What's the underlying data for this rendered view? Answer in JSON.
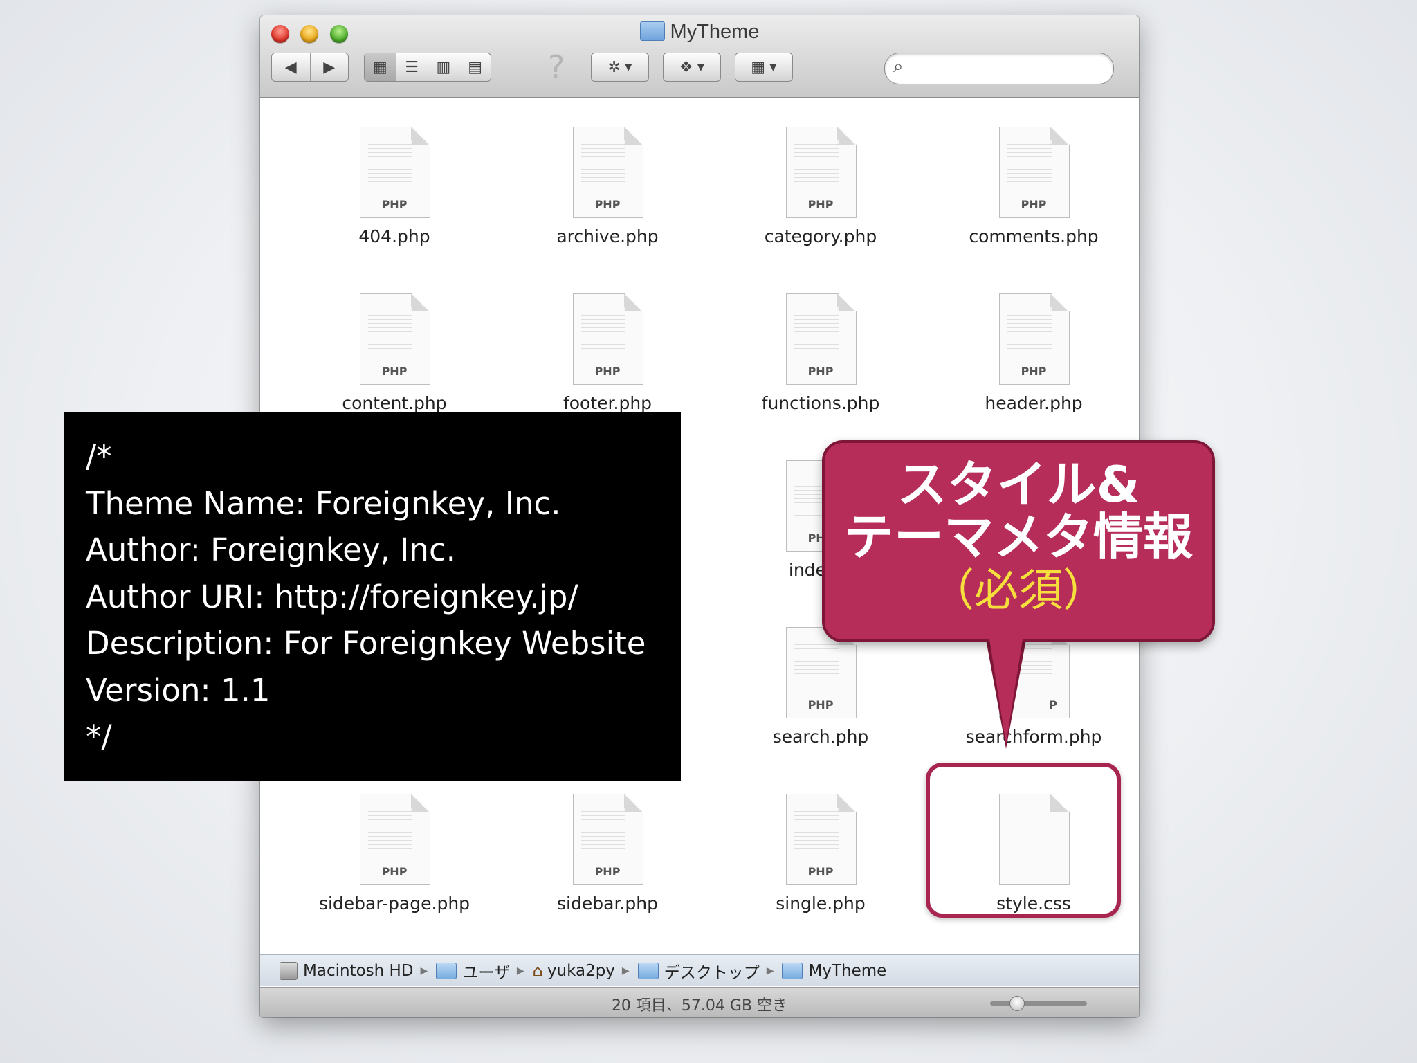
{
  "window": {
    "title": "MyTheme",
    "toolbar": {
      "back_icon": "back-arrow-icon",
      "forward_icon": "forward-arrow-icon",
      "view_modes": [
        "icon-view-icon",
        "list-view-icon",
        "column-view-icon",
        "coverflow-view-icon"
      ],
      "help_glyph": "?",
      "action_icon": "gear-icon",
      "dropbox_icon": "dropbox-icon",
      "arrange_icon": "arrange-icon",
      "search_placeholder": ""
    },
    "files": [
      {
        "name": "404.php",
        "type": "PHP"
      },
      {
        "name": "archive.php",
        "type": "PHP"
      },
      {
        "name": "category.php",
        "type": "PHP"
      },
      {
        "name": "comments.php",
        "type": "PHP"
      },
      {
        "name": "content.php",
        "type": "PHP"
      },
      {
        "name": "footer.php",
        "type": "PHP"
      },
      {
        "name": "functions.php",
        "type": "PHP"
      },
      {
        "name": "header.php",
        "type": "PHP"
      },
      {
        "name": "index.p",
        "type": "PHP"
      },
      {
        "name": "search.php",
        "type": "PHP"
      },
      {
        "name": "searchform.php",
        "type": "P"
      },
      {
        "name": "sidebar-page.php",
        "type": "PHP"
      },
      {
        "name": "sidebar.php",
        "type": "PHP"
      },
      {
        "name": "single.php",
        "type": "PHP"
      },
      {
        "name": "style.css",
        "type": ""
      }
    ],
    "pathbar": [
      "Macintosh HD",
      "ユーザ",
      "yuka2py",
      "デスクトップ",
      "MyTheme"
    ],
    "status": "20 項目、57.04 GB 空き"
  },
  "code_panel": {
    "lines": [
      "/*",
      "Theme Name: Foreignkey, Inc.",
      "Author: Foreignkey, Inc.",
      "Author URI: http://foreignkey.jp/",
      "Description: For Foreignkey Website",
      "Version: 1.1",
      "*/"
    ]
  },
  "callout": {
    "line1": "スタイル&",
    "line2": "テーマメタ情報",
    "line3": "（必須）"
  },
  "colors": {
    "callout_bg": "#b62d5a",
    "callout_accent": "#f6df3d",
    "highlight_border": "#a82550"
  }
}
